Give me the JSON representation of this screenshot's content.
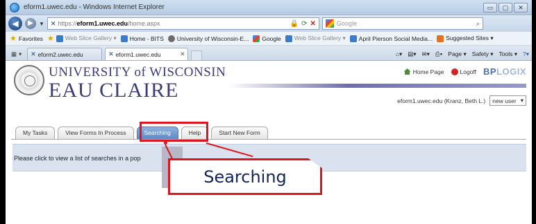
{
  "window": {
    "title": "eform1.uwec.edu - Windows Internet Explorer",
    "buttons": [
      "▭",
      "▢",
      "✕"
    ]
  },
  "address": {
    "scheme": "https://",
    "host": "eform1.uwec.edu",
    "path": "/home.aspx",
    "search_placeholder": "Google"
  },
  "favorites": {
    "label": "Favorites",
    "items": [
      "Web Slice Gallery ▾",
      "Home - BITS",
      "University of Wisconsin-E...",
      "Google",
      "Web Slice Gallery ▾",
      "April Pierson Social Media...",
      "Suggested Sites ▾"
    ]
  },
  "browser_tabs": {
    "tab1": "eform2.uwec.edu",
    "tab2": "eform1.uwec.edu",
    "command_bar": [
      "Page ▾",
      "Safety ▾",
      "Tools ▾"
    ]
  },
  "header": {
    "line1": "UNIVERSITY of WISCONSIN",
    "line2": "EAU CLAIRE",
    "home_page": "Home Page",
    "logoff": "Logoff",
    "bp_logo": "BP",
    "bp_logo_suffix": "LOGIX",
    "user_info": "eform1.uwec.edu (Kranz, Beth L.)",
    "user_select": "new user"
  },
  "form_tabs": [
    "My Tasks",
    "View Forms In Process",
    "Searching",
    "Help",
    "Start New Form"
  ],
  "info_text": "Please click to view a list of searches in a pop",
  "callout": {
    "label": "Searching"
  },
  "colors": {
    "callout_red": "#e0141c",
    "active_tab_blue": "#5f89c6",
    "uw_purple": "#3b3b7a"
  }
}
